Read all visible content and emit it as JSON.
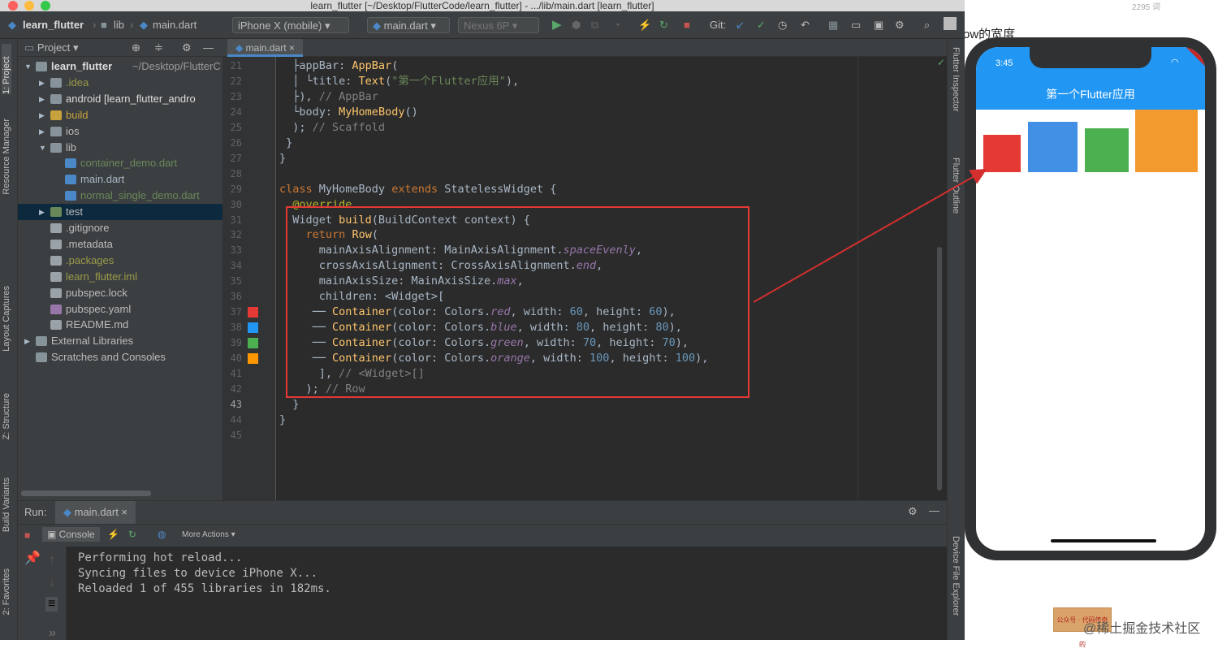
{
  "window": {
    "title": "learn_flutter [~/Desktop/FlutterCode/learn_flutter] - .../lib/main.dart [learn_flutter]",
    "word_count": "2295 词"
  },
  "toolbar": {
    "crumb_project": "learn_flutter",
    "crumb_lib": "lib",
    "crumb_file": "main.dart",
    "device": "iPhone X (mobile)",
    "run_config": "main.dart",
    "emulator": "Nexus 6P",
    "git_label": "Git:"
  },
  "left_tabs": [
    "1: Project",
    "Resource Manager",
    "Layout Captures",
    "Z: Structure",
    "Build Variants",
    "2: Favorites"
  ],
  "right_tabs": [
    "Flutter Inspector",
    "Flutter Outline",
    "Device File Explorer"
  ],
  "project": {
    "header": "Project",
    "tree": [
      {
        "label": "learn_flutter",
        "suffix": "~/Desktop/FlutterC",
        "depth": 0,
        "arrow": "▼",
        "color": "#dcdcdc",
        "icon": "#87939a",
        "bold": true
      },
      {
        "label": ".idea",
        "depth": 1,
        "arrow": "▶",
        "color": "#9a9a4a",
        "icon": "#87939a"
      },
      {
        "label": "android [learn_flutter_andro",
        "depth": 1,
        "arrow": "▶",
        "color": "#dcdcdc",
        "icon": "#87939a"
      },
      {
        "label": "build",
        "depth": 1,
        "arrow": "▶",
        "color": "#c8a23c",
        "icon": "#c8a23c"
      },
      {
        "label": "ios",
        "depth": 1,
        "arrow": "▶",
        "color": "#bbbbbb",
        "icon": "#87939a"
      },
      {
        "label": "lib",
        "depth": 1,
        "arrow": "▼",
        "color": "#bbbbbb",
        "icon": "#87939a"
      },
      {
        "label": "container_demo.dart",
        "depth": 2,
        "arrow": "",
        "color": "#6a8759",
        "icon": "#4a88c7"
      },
      {
        "label": "main.dart",
        "depth": 2,
        "arrow": "",
        "color": "#a9b7c6",
        "icon": "#4a88c7"
      },
      {
        "label": "normal_single_demo.dart",
        "depth": 2,
        "arrow": "",
        "color": "#6a8759",
        "icon": "#4a88c7"
      },
      {
        "label": "test",
        "depth": 1,
        "arrow": "▶",
        "color": "#bbbbbb",
        "icon": "#6a8759",
        "selected": true
      },
      {
        "label": ".gitignore",
        "depth": 1,
        "arrow": "",
        "color": "#bbbbbb",
        "icon": "#9aa2a7"
      },
      {
        "label": ".metadata",
        "depth": 1,
        "arrow": "",
        "color": "#bbbbbb",
        "icon": "#9aa2a7"
      },
      {
        "label": ".packages",
        "depth": 1,
        "arrow": "",
        "color": "#9a9a4a",
        "icon": "#9aa2a7"
      },
      {
        "label": "learn_flutter.iml",
        "depth": 1,
        "arrow": "",
        "color": "#9a9a4a",
        "icon": "#9aa2a7"
      },
      {
        "label": "pubspec.lock",
        "depth": 1,
        "arrow": "",
        "color": "#bbbbbb",
        "icon": "#9aa2a7"
      },
      {
        "label": "pubspec.yaml",
        "depth": 1,
        "arrow": "",
        "color": "#bbbbbb",
        "icon": "#9876aa"
      },
      {
        "label": "README.md",
        "depth": 1,
        "arrow": "",
        "color": "#bbbbbb",
        "icon": "#9aa2a7"
      },
      {
        "label": "External Libraries",
        "depth": 0,
        "arrow": "▶",
        "color": "#bbbbbb",
        "icon": "#87939a"
      },
      {
        "label": "Scratches and Consoles",
        "depth": 0,
        "arrow": "",
        "color": "#bbbbbb",
        "icon": "#87939a"
      }
    ]
  },
  "editor": {
    "tab": "main.dart",
    "lines": [
      {
        "n": "21",
        "html": "  <span>├appBar: </span><span class='cls'>AppBar</span>("
      },
      {
        "n": "22",
        "html": "  <span>│ └title: </span><span class='cls'>Text</span>(<span class='str'>\"第一个Flutter应用\"</span>),"
      },
      {
        "n": "23",
        "html": "  <span>├), </span><span class='cm'>// AppBar</span>"
      },
      {
        "n": "24",
        "html": "  <span>└body: </span><span class='cls'>MyHomeBody</span>()"
      },
      {
        "n": "25",
        "html": "  ); <span class='cm'>// Scaffold</span>"
      },
      {
        "n": "26",
        "html": " }"
      },
      {
        "n": "27",
        "html": "}"
      },
      {
        "n": "28",
        "html": ""
      },
      {
        "n": "29",
        "html": "<span class='kw'>class</span> MyHomeBody <span class='kw'>extends</span> StatelessWidget {"
      },
      {
        "n": "30",
        "html": "  <span class='ann'>@override</span>"
      },
      {
        "n": "31",
        "html": "  Widget <span class='cls'>build</span>(BuildContext context) {"
      },
      {
        "n": "32",
        "html": "    <span class='kw'>return</span> <span class='cls'>Row</span>("
      },
      {
        "n": "33",
        "html": "      mainAxisAlignment: MainAxisAlignment.<span class='it'>spaceEvenly</span>,"
      },
      {
        "n": "34",
        "html": "      crossAxisAlignment: CrossAxisAlignment.<span class='it'>end</span>,"
      },
      {
        "n": "35",
        "html": "      mainAxisSize: MainAxisSize.<span class='it'>max</span>,"
      },
      {
        "n": "36",
        "html": "      children: &lt;Widget&gt;["
      },
      {
        "n": "37",
        "html": "     ── <span class='cls'>Container</span>(color: Colors.<span class='it'>red</span>, width: <span class='num'>60</span>, height: <span class='num'>60</span>),"
      },
      {
        "n": "38",
        "html": "     ── <span class='cls'>Container</span>(color: Colors.<span class='it'>blue</span>, width: <span class='num'>80</span>, height: <span class='num'>80</span>),"
      },
      {
        "n": "39",
        "html": "     ── <span class='cls'>Container</span>(color: Colors.<span class='it'>green</span>, width: <span class='num'>70</span>, height: <span class='num'>70</span>),"
      },
      {
        "n": "40",
        "html": "     ── <span class='cls'>Container</span>(color: Colors.<span class='it'>orange</span>, width: <span class='num'>100</span>, height: <span class='num'>100</span>),"
      },
      {
        "n": "41",
        "html": "      ], <span class='cm'>// &lt;Widget&gt;[]</span>"
      },
      {
        "n": "42",
        "html": "    ); <span class='cm'>// Row</span>"
      },
      {
        "n": "43",
        "html": "  }"
      },
      {
        "n": "44",
        "html": "}"
      },
      {
        "n": "45",
        "html": ""
      }
    ],
    "swatches": [
      {
        "line": "37",
        "color": "#e53935"
      },
      {
        "line": "38",
        "color": "#2196f3"
      },
      {
        "line": "39",
        "color": "#4caf50"
      },
      {
        "line": "40",
        "color": "#ff9800"
      }
    ]
  },
  "run": {
    "label": "Run:",
    "tab": "main.dart",
    "console_tab": "Console",
    "more_actions": "More Actions",
    "output": [
      "Performing hot reload...",
      "Syncing files to device iPhone X...",
      "Reloaded 1 of 455 libraries in 182ms."
    ]
  },
  "phone": {
    "time": "3:45",
    "app_title": "第一个Flutter应用",
    "boxes": [
      {
        "name": "red",
        "color": "#e53935",
        "size": 60
      },
      {
        "name": "blue",
        "color": "#4190e6",
        "size": 80
      },
      {
        "name": "green",
        "color": "#4caf50",
        "size": 70
      },
      {
        "name": "orange",
        "color": "#f39a2f",
        "size": 100
      }
    ]
  },
  "article": {
    "partial_text": "ow的宽度",
    "badge_text": "公众号 · 代码传奇的",
    "footer_text": "@稀土掘金技术社区"
  },
  "colors": {
    "highlight_box": "#e53935",
    "arrow": "#d32f2f"
  }
}
